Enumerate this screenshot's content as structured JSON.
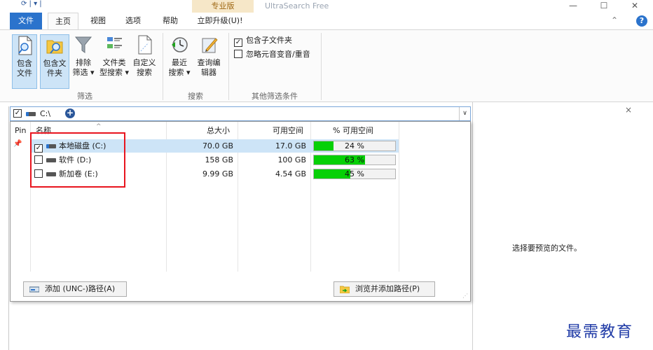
{
  "titlebar": {
    "quick_access": "⟳ | ▾ |",
    "upgrade_tab": "专业版",
    "title": "UltraSearch Free",
    "minimize": "—",
    "maximize": "☐",
    "close": "✕"
  },
  "tabs": {
    "file": "文件",
    "home": "主页",
    "view": "视图",
    "options": "选项",
    "help": "帮助",
    "upgrade": "立即升级(U)!",
    "collapse": "⌃",
    "help_icon": "?"
  },
  "ribbon": {
    "filter": {
      "btn_include_files": [
        "包含",
        "文件"
      ],
      "btn_include_folders": [
        "包含文",
        "件夹"
      ],
      "btn_exclude": [
        "排除",
        "筛选 ▾"
      ],
      "btn_file_type": [
        "文件类",
        "型搜索 ▾"
      ],
      "btn_custom": [
        "自定义",
        "搜索"
      ],
      "label": "筛选"
    },
    "search": {
      "btn_recent": [
        "最近",
        "搜索 ▾"
      ],
      "btn_query_editor": [
        "查询编",
        "辑器"
      ],
      "label": "搜索"
    },
    "other": {
      "include_subfolders": "包含子文件夹",
      "include_subfolders_checked": true,
      "ignore_diacritics": "忽略元音变音/重音",
      "ignore_diacritics_checked": false,
      "label": "其他筛选条件"
    }
  },
  "pathbar": {
    "checked": true,
    "path": "C:\\",
    "add": "+",
    "dropdown": "∨"
  },
  "drive_list": {
    "columns": {
      "pin": "Pin",
      "name": "名称",
      "total": "总大小",
      "free": "可用空间",
      "pct": "% 可用空间"
    },
    "sort_indicator": "^",
    "pin_glyph": "📌",
    "rows": [
      {
        "checked": true,
        "name": "本地磁盘 (C:)",
        "total": "70.0 GB",
        "free": "17.0 GB",
        "pct_label": "24 %",
        "pct_value": 24,
        "selected": true,
        "system": true
      },
      {
        "checked": false,
        "name": "软件 (D:)",
        "total": "158 GB",
        "free": "100 GB",
        "pct_label": "63 %",
        "pct_value": 63,
        "selected": false,
        "system": false
      },
      {
        "checked": false,
        "name": "新加卷 (E:)",
        "total": "9.99 GB",
        "free": "4.54 GB",
        "pct_label": "45 %",
        "pct_value": 45,
        "selected": false,
        "system": false
      }
    ],
    "add_unc_button": "添加 (UNC-)路径(A)",
    "browse_button": "浏览并添加路径(P)"
  },
  "preview": {
    "close": "×",
    "message": "选择要预览的文件。"
  },
  "watermark": "最需教育",
  "colors": {
    "accent": "#2b73cc",
    "bar_fill": "#06d006",
    "highlight": "#e8141e",
    "selected_row": "#cde4f7"
  }
}
